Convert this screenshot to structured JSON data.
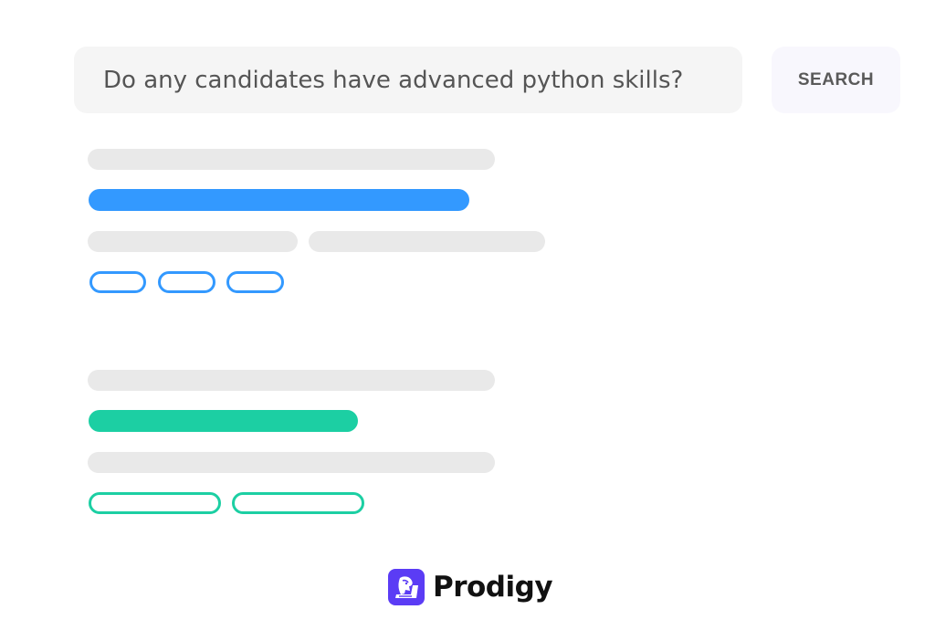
{
  "search": {
    "query": "Do any candidates have advanced python skills?",
    "button_label": "SEARCH"
  },
  "results": [
    {
      "accent": "#3399ff",
      "pill_count": 3
    },
    {
      "accent": "#1ccfa3",
      "pill_count": 2
    }
  ],
  "colors": {
    "placeholder_bar": "#e9e9e9",
    "search_bg": "#f5f5f5",
    "brand": "#5b3cf5"
  },
  "brand": {
    "name": "Prodigy",
    "logo_icon": "prodigy-logo-icon"
  }
}
